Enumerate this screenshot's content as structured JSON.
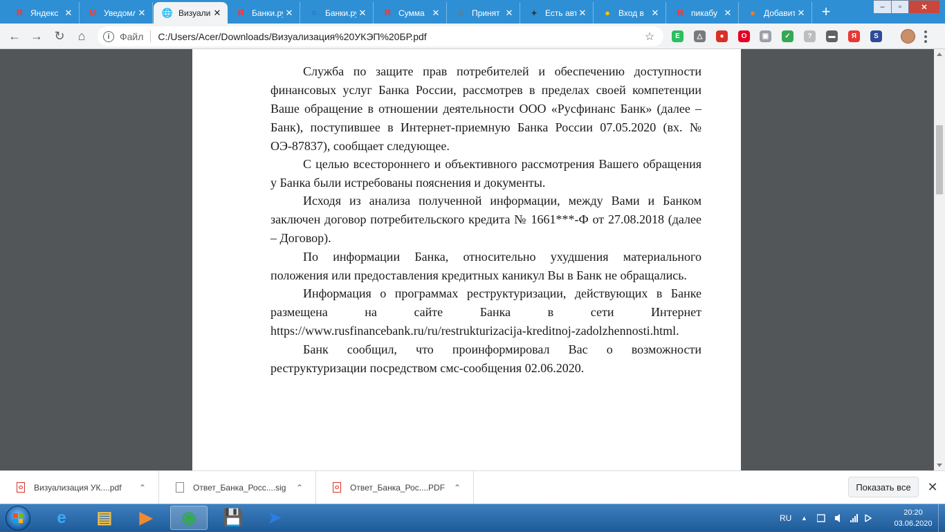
{
  "browser": {
    "tabs": [
      {
        "title": "Яндекс",
        "favicon": "yandex-icon",
        "favicon_glyph": "Я",
        "color": "#ff3333"
      },
      {
        "title": "Уведомления",
        "favicon": "gmail-icon",
        "favicon_glyph": "M",
        "color": "#ea4335"
      },
      {
        "title": "Визуализация",
        "favicon": "globe-icon",
        "favicon_glyph": "🌐",
        "color": "#5f6368"
      },
      {
        "title": "Банки.ру",
        "favicon": "yandex-icon",
        "favicon_glyph": "Я",
        "color": "#ff3333"
      },
      {
        "title": "Банки.ру",
        "favicon": "banki-icon",
        "favicon_glyph": "≡",
        "color": "#2b6ed6"
      },
      {
        "title": "Сумма",
        "favicon": "yandex-icon",
        "favicon_glyph": "Я",
        "color": "#ff3333"
      },
      {
        "title": "Принят",
        "favicon": "person-icon",
        "favicon_glyph": "☺",
        "color": "#8a6a4a"
      },
      {
        "title": "Есть авто",
        "favicon": "plus-square-icon",
        "favicon_glyph": "+",
        "color": "#222222"
      },
      {
        "title": "Вход в",
        "favicon": "beeline-icon",
        "favicon_glyph": "●",
        "color": "#f5c400"
      },
      {
        "title": "пикабу",
        "favicon": "yandex-icon",
        "favicon_glyph": "Я",
        "color": "#ff3333"
      },
      {
        "title": "Добавить",
        "favicon": "pikabu-icon",
        "favicon_glyph": "●",
        "color": "#f47c20"
      }
    ],
    "active_tab_index": 2,
    "new_tab_glyph": "+",
    "window_controls": {
      "minimize": "–",
      "maximize": "▫",
      "close": "✕"
    },
    "toolbar": {
      "back": "←",
      "forward": "→",
      "reload": "↻",
      "home": "⌂",
      "info_glyph": "i",
      "scheme": "Файл",
      "url": "C:/Users/Acer/Downloads/Визуализация%20УКЭП%20БР.pdf",
      "star": "☆"
    },
    "extensions": [
      {
        "name": "evernote-icon",
        "glyph": "E",
        "color": "#2dbe60"
      },
      {
        "name": "drive-icon",
        "glyph": "△",
        "color": "#7a7a7a"
      },
      {
        "name": "chat-icon",
        "glyph": "●",
        "color": "#d93025"
      },
      {
        "name": "opera-icon",
        "glyph": "O",
        "color": "#e60023"
      },
      {
        "name": "lock-icon",
        "glyph": "▣",
        "color": "#9aa0a6"
      },
      {
        "name": "shield-check-icon",
        "glyph": "✓",
        "color": "#34a853"
      },
      {
        "name": "help-icon",
        "glyph": "?",
        "color": "#bdbdbd"
      },
      {
        "name": "dash-icon",
        "glyph": "▬",
        "color": "#5f6368"
      },
      {
        "name": "yandex-ext-icon",
        "glyph": "Я",
        "color": "#e53935"
      },
      {
        "name": "s-ext-icon",
        "glyph": "S",
        "color": "#2f4a9b"
      }
    ]
  },
  "document": {
    "paragraphs": [
      "Служба по защите прав потребителей и обеспечению доступности финансовых услуг Банка России, рассмотрев в пределах своей компетенции Ваше обращение в отношении деятельности ООО «Русфинанс Банк» (далее – Банк), поступившее в Интернет-приемную Банка России 07.05.2020 (вх. № ОЭ-87837), сообщает следующее.",
      "С целью всестороннего и объективного рассмотрения Вашего обращения у Банка были истребованы пояснения и документы.",
      "Исходя из анализа полученной информации, между Вами и Банком заключен договор потребительского кредита № 1661***-Ф от 27.08.2018 (далее – Договор).",
      "По информации Банка, относительно ухудшения материального положения или предоставления кредитных каникул Вы в Банк не обращались.",
      "Информация о программах реструктуризации, действующих в Банке размещена на сайте Банка в сети Интернет https://www.rusfinancebank.ru/ru/restrukturizacija-kreditnoj-zadolzhennosti.html.",
      "Банк сообщил, что проинформировал Вас о возможности реструктуризации посредством смс-сообщения 02.06.2020."
    ]
  },
  "downloads": {
    "items": [
      {
        "name": "Визуализация УК....pdf",
        "type": "pdf"
      },
      {
        "name": "Ответ_Банка_Росс....sig",
        "type": "file"
      },
      {
        "name": "Ответ_Банка_Рос....PDF",
        "type": "pdf"
      }
    ],
    "chevron": "⌃",
    "show_all": "Показать все",
    "close": "✕"
  },
  "taskbar": {
    "apps": [
      {
        "name": "internet-explorer-icon",
        "glyph": "e",
        "color": "#3fa9f5"
      },
      {
        "name": "file-explorer-icon",
        "glyph": "▤",
        "color": "#f0c050"
      },
      {
        "name": "media-player-icon",
        "glyph": "▶",
        "color": "#f08a30"
      },
      {
        "name": "chrome-icon",
        "glyph": "◉",
        "color": "#34a853"
      },
      {
        "name": "save-disk-icon",
        "glyph": "💾",
        "color": "#2f5fc8"
      },
      {
        "name": "arrow-app-icon",
        "glyph": "➤",
        "color": "#2a7de1"
      }
    ],
    "active_app_index": 3,
    "language": "RU",
    "tray_up": "▲",
    "time": "20:20",
    "date": "03.06.2020"
  }
}
